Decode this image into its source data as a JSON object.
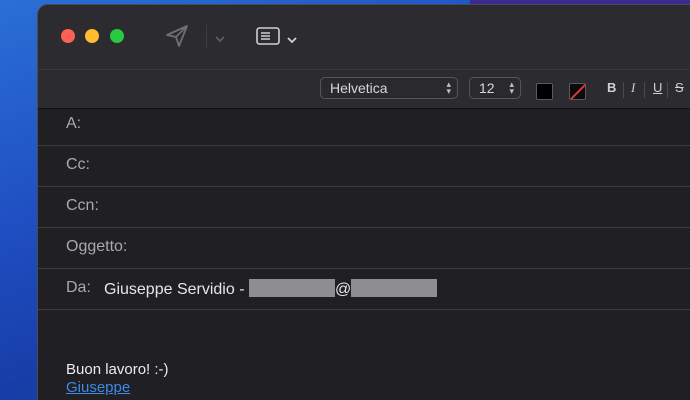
{
  "toolbar": {
    "send_icon": "paper-plane-icon",
    "header_icon": "list-header-icon"
  },
  "format": {
    "font": "Helvetica",
    "size": "12",
    "text_color": "#000000",
    "bold": "B",
    "italic": "I",
    "underline": "U",
    "strike": "S"
  },
  "fields": {
    "to_label": "A:",
    "cc_label": "Cc:",
    "bcc_label": "Ccn:",
    "subject_label": "Oggetto:",
    "from_label": "Da:",
    "from_name": "Giuseppe Servidio - ",
    "from_at": "@"
  },
  "body": {
    "line1": "Buon lavoro! :-)",
    "signature_link": "Giuseppe"
  },
  "colors": {
    "close": "#fe5f57",
    "minimize": "#febc2e",
    "maximize": "#28c840",
    "link": "#3d8ae8"
  }
}
